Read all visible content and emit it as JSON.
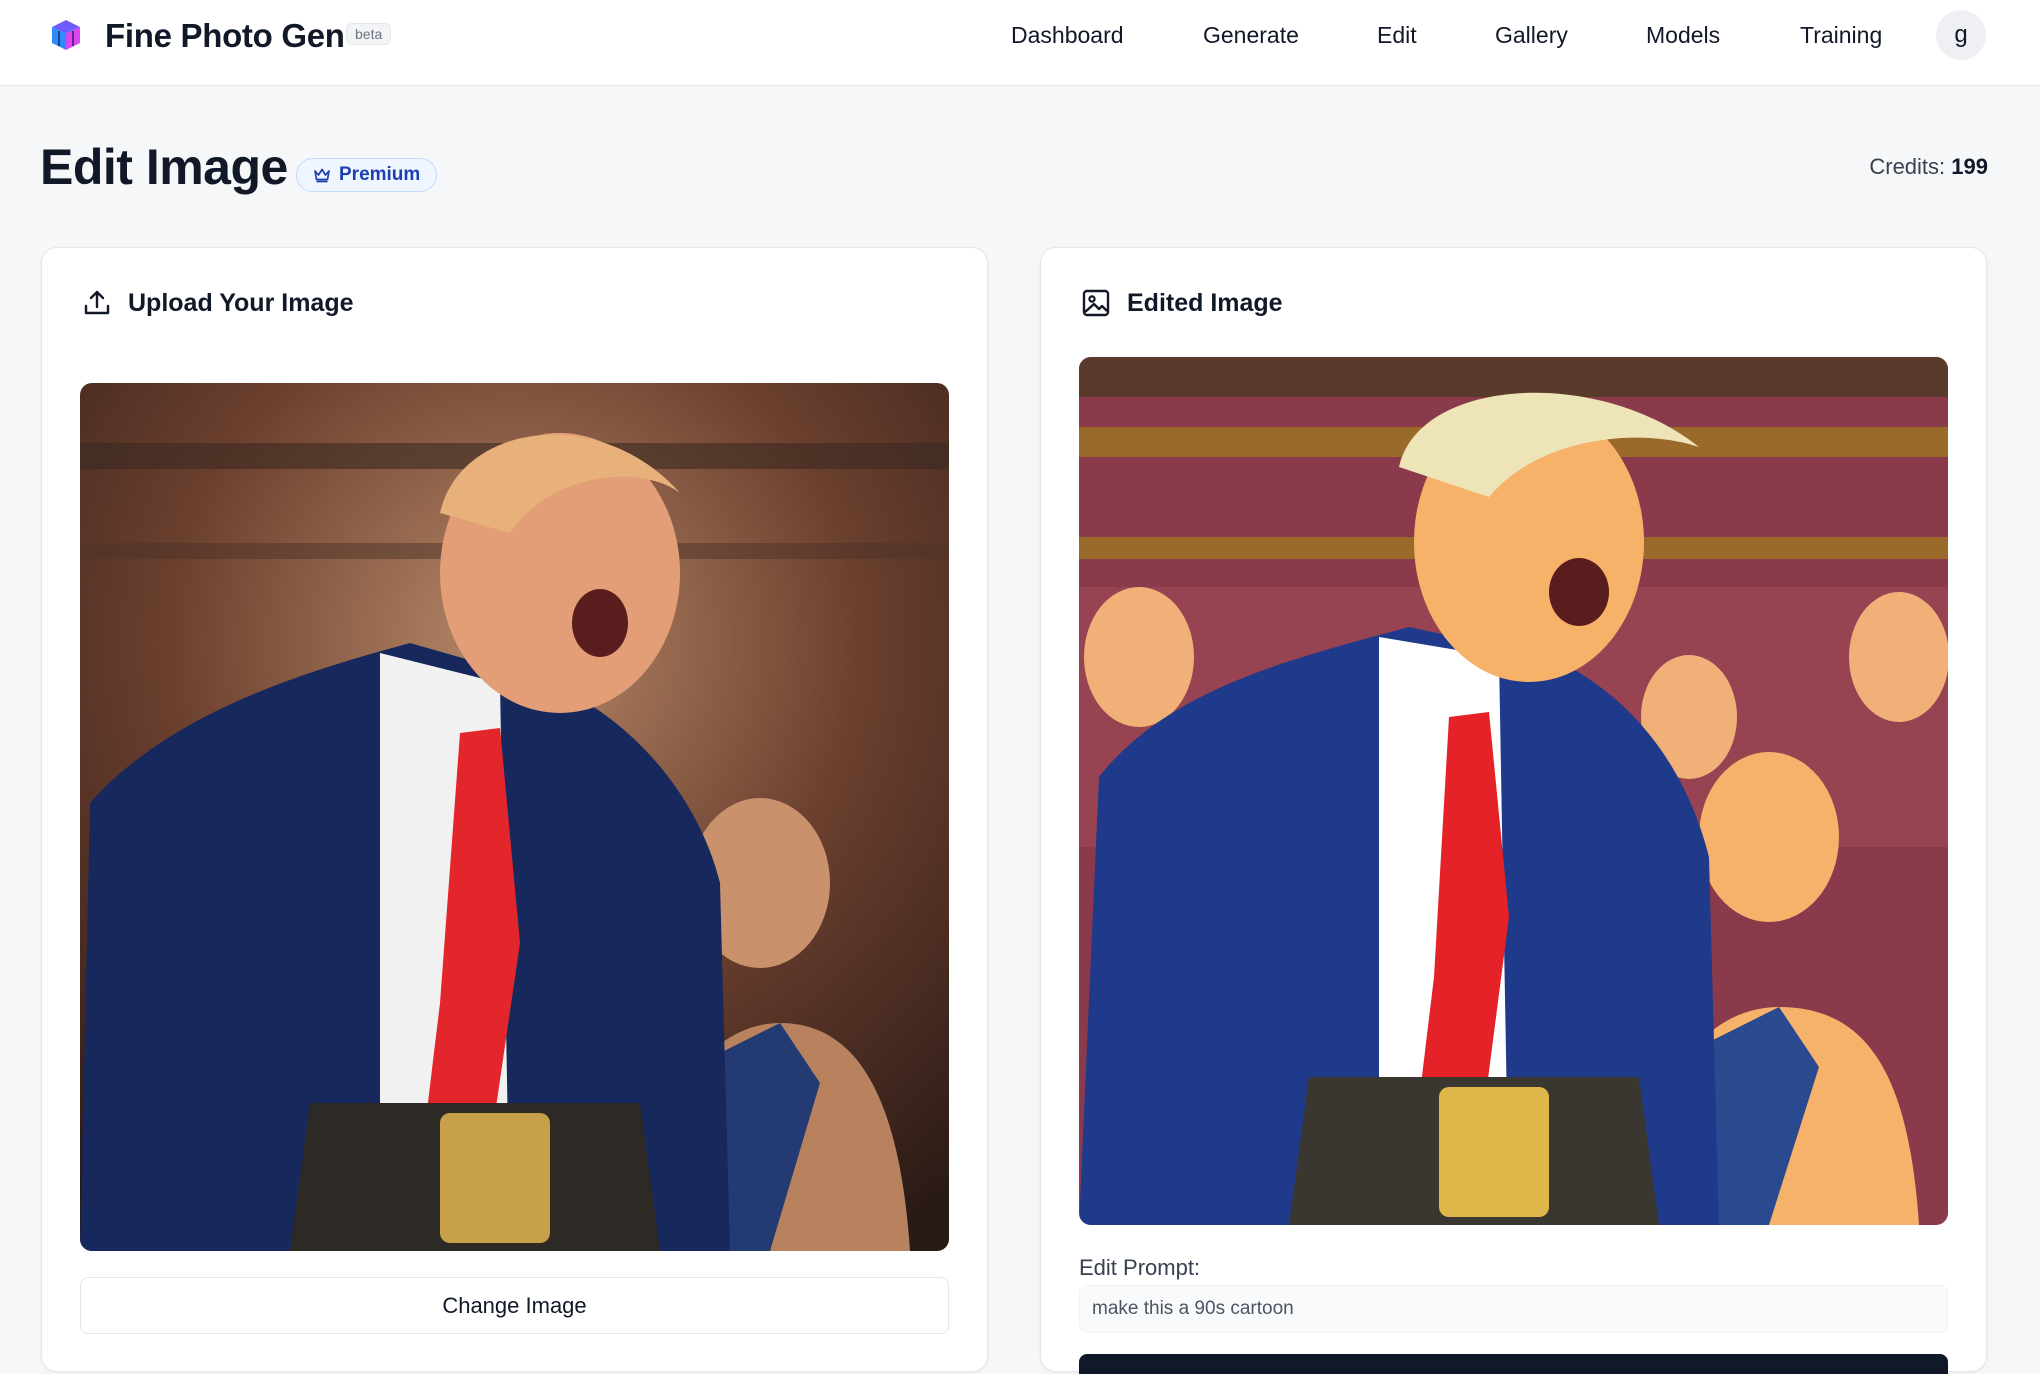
{
  "app": {
    "name": "Fine Photo Gen",
    "badge": "beta",
    "user_initial": "g"
  },
  "nav": {
    "items": [
      "Dashboard",
      "Generate",
      "Edit",
      "Gallery",
      "Models",
      "Training"
    ]
  },
  "page": {
    "title": "Edit Image",
    "tier_badge": "Premium",
    "credits_label": "Credits:",
    "credits_value": "199"
  },
  "upload_panel": {
    "title": "Upload Your Image",
    "image_alt": "Uploaded photo: a man in a navy suit and red tie holding a championship belt in a crowded arena",
    "change_button": "Change Image"
  },
  "edited_panel": {
    "title": "Edited Image",
    "image_alt": "Cartoon-style edit of the uploaded arena photo",
    "prompt_label": "Edit Prompt:",
    "prompt_value": "make this a 90s cartoon"
  },
  "colors": {
    "accent_badge": "#1e40af",
    "primary_button": "#111827",
    "background": "#f6f7f9"
  },
  "icons": {
    "upload": "upload-icon",
    "image": "image-icon",
    "crown": "crown-icon",
    "logo": "cube-logo-icon"
  }
}
